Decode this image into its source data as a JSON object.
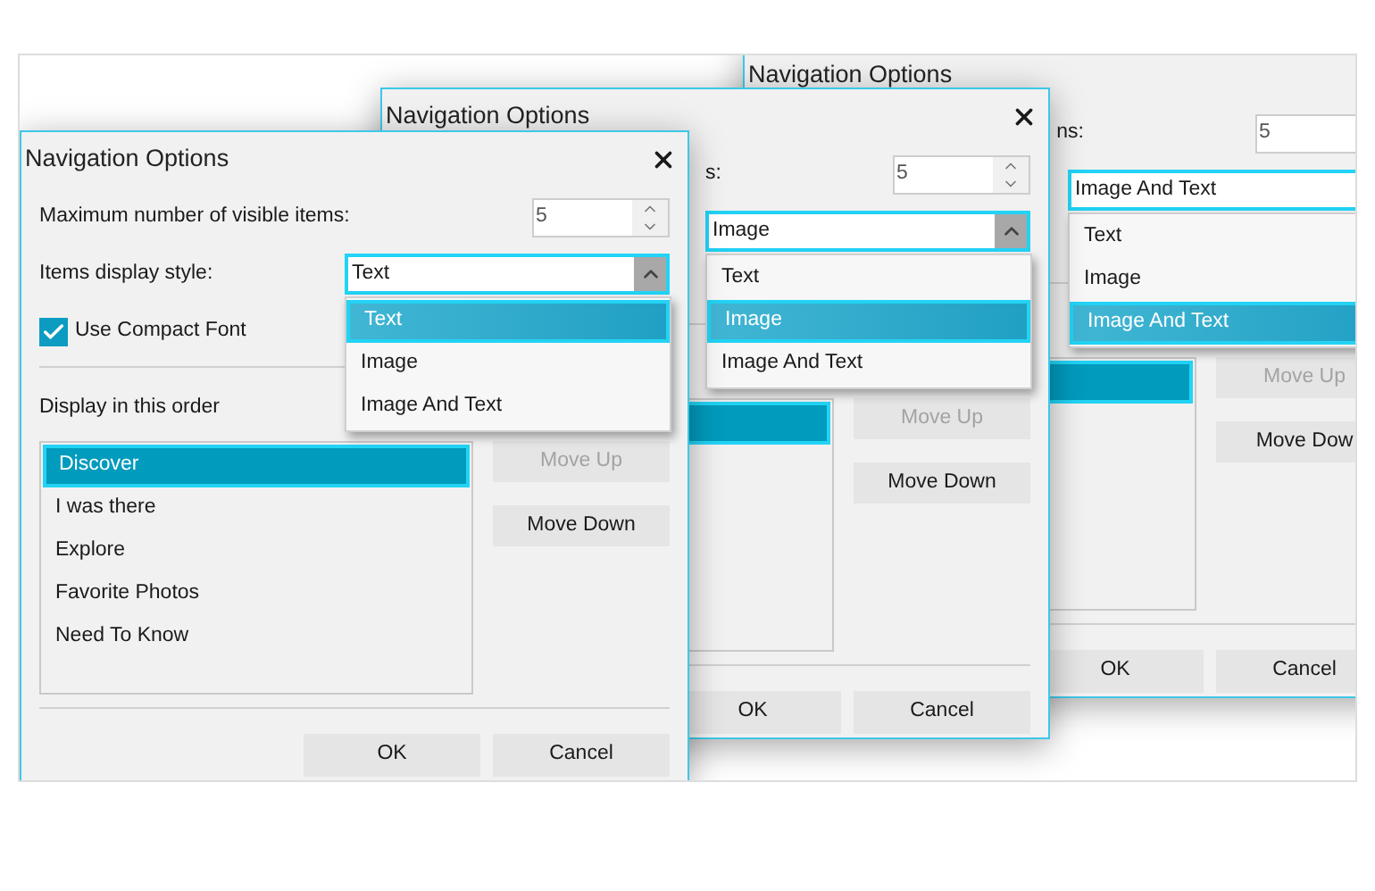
{
  "dialogs": [
    {
      "title": "Navigation Options",
      "right_edge_visible": true,
      "max_items": {
        "label": "Maximum number of visible items:",
        "clipped_left": false,
        "value": "5"
      },
      "display_style": {
        "label": "Items display style:",
        "value": "Text",
        "expanded": true,
        "options": [
          {
            "label": "Text",
            "selected": true
          },
          {
            "label": "Image",
            "selected": false
          },
          {
            "label": "Image And Text",
            "selected": false
          }
        ]
      },
      "compact_font": {
        "label": "Use Compact Font",
        "checked": true
      },
      "order_label": "Display in this order",
      "order_list": [
        {
          "label": "Discover",
          "selected": true
        },
        {
          "label": "I was there",
          "selected": false
        },
        {
          "label": "Explore",
          "selected": false
        },
        {
          "label": "Favorite Photos",
          "selected": false
        },
        {
          "label": "Need To Know",
          "selected": false
        }
      ],
      "side_buttons": [
        {
          "label": "Move Up",
          "disabled": true
        },
        {
          "label": "Move Down",
          "disabled": false
        }
      ],
      "footer_buttons": [
        {
          "label": "OK"
        },
        {
          "label": "Cancel"
        }
      ]
    },
    {
      "title": "Navigation Options",
      "right_edge_visible": true,
      "max_items": {
        "label": "s:",
        "clipped_left": true,
        "value": "5"
      },
      "display_style": {
        "value": "Image",
        "expanded": true,
        "options": [
          {
            "label": "Text",
            "selected": false
          },
          {
            "label": "Image",
            "selected": true
          },
          {
            "label": "Image And Text",
            "selected": false
          }
        ]
      },
      "order_list": [
        {
          "selected": true
        }
      ],
      "side_buttons": [
        {
          "label": "Move Up",
          "disabled": true
        },
        {
          "label": "Move Down",
          "disabled": false
        }
      ],
      "footer_buttons": [
        {
          "label": "OK"
        },
        {
          "label": "Cancel"
        }
      ]
    },
    {
      "title": "Navigation Options",
      "right_edge_visible": false,
      "max_items": {
        "label": "ns:",
        "clipped_left": true,
        "value": "5"
      },
      "display_style": {
        "value": "Image And Text",
        "expanded": true,
        "options": [
          {
            "label": "Text",
            "selected": false
          },
          {
            "label": "Image",
            "selected": false
          },
          {
            "label": "Image And Text",
            "selected": true
          }
        ]
      },
      "order_list": [
        {
          "selected": true
        }
      ],
      "side_buttons": [
        {
          "label": "Move Up",
          "disabled": true
        },
        {
          "label": "Move Dow",
          "disabled": false
        }
      ],
      "footer_buttons": [
        {
          "label": "OK"
        },
        {
          "label": "Cancel"
        }
      ]
    }
  ]
}
